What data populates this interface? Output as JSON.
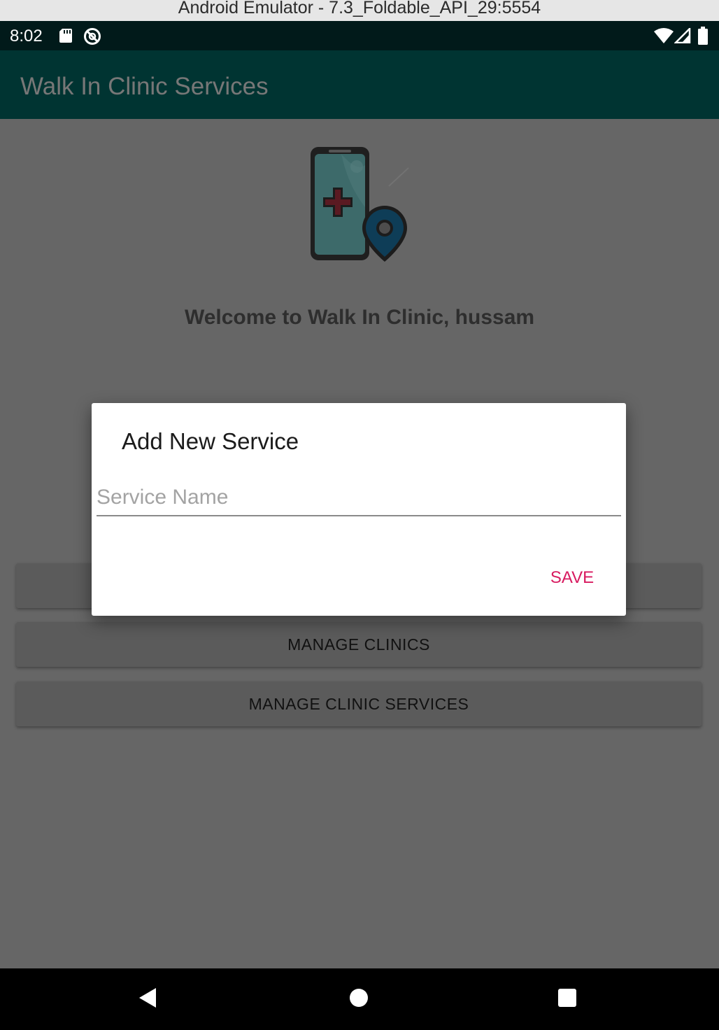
{
  "window": {
    "title": "Android Emulator - 7.3_Foldable_API_29:5554"
  },
  "status_bar": {
    "time": "8:02",
    "icons": [
      "sd-card-icon",
      "sync-icon",
      "wifi-icon",
      "signal-icon",
      "battery-icon"
    ]
  },
  "app_bar": {
    "title": "Walk In Clinic Services"
  },
  "main": {
    "logo": "phone-medical-location-logo",
    "welcome": "Welcome to Walk In Clinic, hussam",
    "buttons": [
      {
        "label": ""
      },
      {
        "label": "MANAGE CLINICS"
      },
      {
        "label": "MANAGE CLINIC SERVICES"
      }
    ]
  },
  "dialog": {
    "title": "Add New Service",
    "input": {
      "placeholder": "Service Name",
      "value": ""
    },
    "save_label": "SAVE"
  },
  "nav_bar": {
    "icons": [
      "back-icon",
      "home-icon",
      "recents-icon"
    ]
  },
  "colors": {
    "status_bar": "#011a1a",
    "app_bar": "#003432",
    "accent": "#d81b60",
    "scrim_background": "#666666",
    "dialog": "#ffffff"
  }
}
